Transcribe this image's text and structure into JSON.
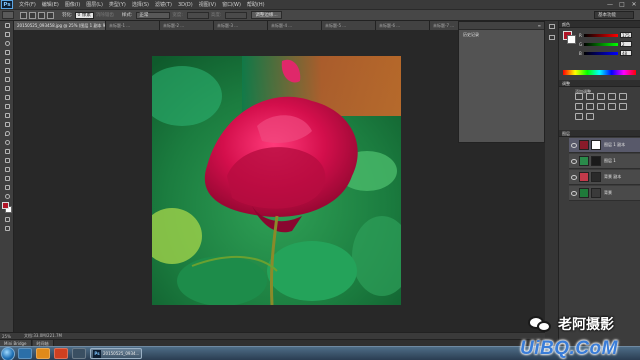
{
  "app": {
    "logo": "Ps",
    "window_controls": [
      "—",
      "□",
      "✕"
    ]
  },
  "menu": [
    "文件(F)",
    "编辑(E)",
    "图像(I)",
    "图层(L)",
    "类型(Y)",
    "选择(S)",
    "滤镜(T)",
    "3D(D)",
    "视图(V)",
    "窗口(W)",
    "帮助(H)"
  ],
  "options": {
    "feather_label": "羽化:",
    "feather_value": "0 像素",
    "antialias": "消除锯齿",
    "style_label": "样式:",
    "style_value": "正常",
    "width_label": "宽度:",
    "height_label": "高度:",
    "refine_button": "调整边缘...",
    "workspace": "基本功能"
  },
  "doc_tabs": [
    "20150525_093458.jpg @ 25% (图层 1 副本 9/8)",
    "未标题-1 ...",
    "未标题-2 ...",
    "未标题-3 ...",
    "未标题-4 ...",
    "未标题-5 ...",
    "未标题-6 ...",
    "未标题-7 ..."
  ],
  "status": {
    "zoom": "25%",
    "doc": "文档:33.0M/221.7M"
  },
  "mini_bridge": [
    "Mini Bridge",
    "时间轴"
  ],
  "float_panel": {
    "tab": "历史记录",
    "menu": "≡"
  },
  "color_panel": {
    "title": "颜色",
    "sliders": [
      {
        "label": "R",
        "value": "175",
        "color": "#d23a3a"
      },
      {
        "label": "G",
        "value": "2",
        "color": "#3aa34a"
      },
      {
        "label": "B",
        "value": "48",
        "color": "#3a5fd2"
      }
    ]
  },
  "adjust_panel": {
    "title": "调整",
    "subtitle": "添加调整"
  },
  "layers_panel": {
    "title": "图层",
    "layers": [
      {
        "name": "图层 1 副本",
        "thumb": "#8a1a2a",
        "mask": "#ffffff"
      },
      {
        "name": "图层 1",
        "thumb": "#2a8a4a",
        "mask": "#1a1a1a"
      },
      {
        "name": "背景 副本",
        "thumb": "#c23a4a",
        "mask": "#2a2a2a"
      },
      {
        "name": "背景",
        "thumb": "#1f7a3a",
        "mask": "#3a3a3a"
      }
    ]
  },
  "taskbar": {
    "ps_label": "20150525_0934..."
  },
  "watermark": {
    "name": "老阿摄影",
    "url": "UiBQ.CoM"
  },
  "colors": {
    "foreground": "#b01426",
    "background": "#ffffff",
    "accent": "#3a7dd8"
  }
}
